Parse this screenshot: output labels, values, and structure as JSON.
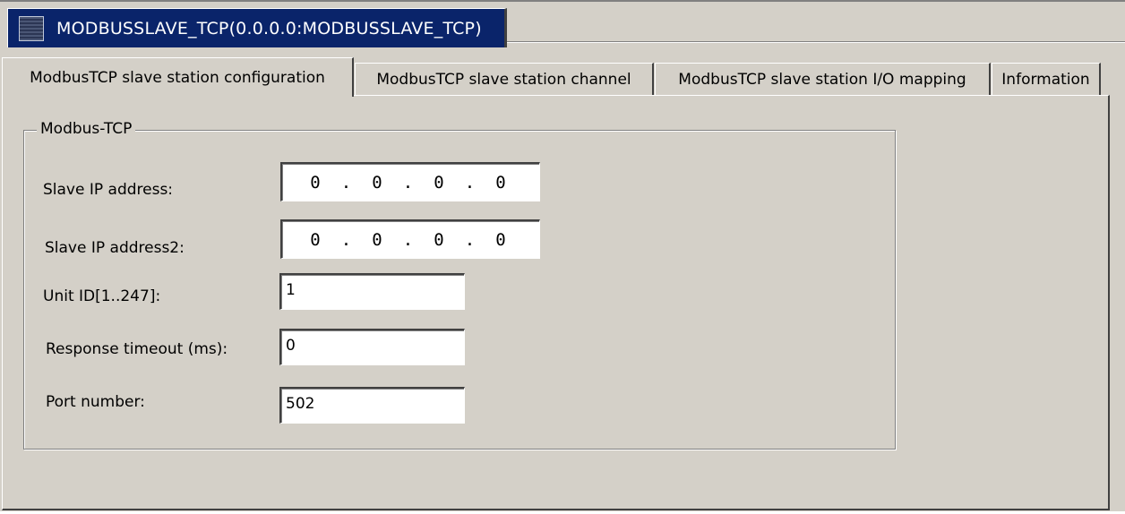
{
  "document_tab": {
    "title": "MODBUSSLAVE_TCP(0.0.0.0:MODBUSSLAVE_TCP)",
    "icon": "device-grid-icon"
  },
  "tabs": [
    {
      "label": "ModbusTCP slave station configuration",
      "active": true
    },
    {
      "label": "ModbusTCP slave station channel",
      "active": false
    },
    {
      "label": "ModbusTCP slave station I/O mapping",
      "active": false
    },
    {
      "label": "Information",
      "active": false
    }
  ],
  "group": {
    "legend": "Modbus-TCP",
    "slave_ip": {
      "label": "Slave IP address:",
      "octets": [
        "0",
        "0",
        "0",
        "0"
      ]
    },
    "slave_ip2": {
      "label": "Slave IP address2:",
      "octets": [
        "0",
        "0",
        "0",
        "0"
      ]
    },
    "unit_id": {
      "label": "Unit ID[1..247]:",
      "value": "1"
    },
    "response_timeout": {
      "label": "Response timeout (ms):",
      "value": "0"
    },
    "port_number": {
      "label": "Port number:",
      "value": "502"
    }
  },
  "colors": {
    "background": "#d4d0c8",
    "doc_tab_active": "#0a246a",
    "input_background": "#ffffff"
  }
}
